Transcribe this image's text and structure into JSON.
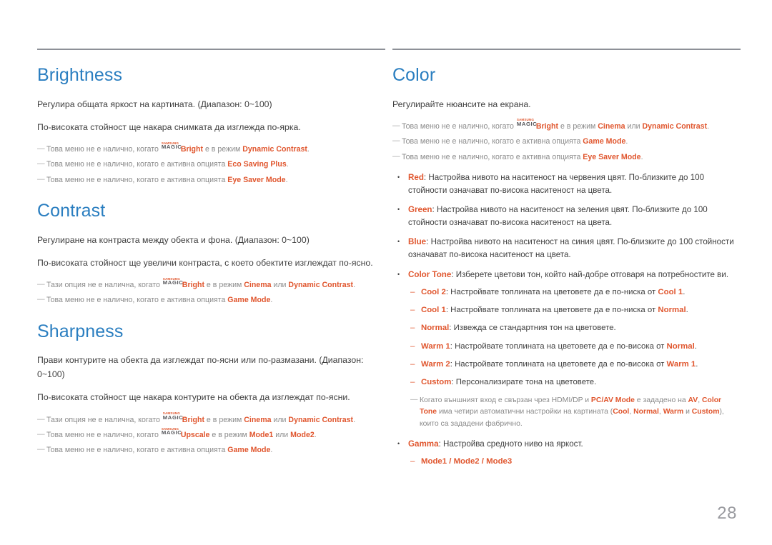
{
  "page": {
    "number": "28",
    "language": "bg",
    "accent_blue": "#2a7ec0",
    "accent_orange": "#e0562e",
    "note_gray": "#8a8a8a",
    "rule_gray": "#8d9097"
  },
  "brand": {
    "magic_top": "SAMSUNG",
    "magic_bottom": "MAGIC"
  },
  "left_column": {
    "sections": [
      {
        "title": "Brightness",
        "body": [
          "Регулира общата яркост на картината. (Диапазон: 0~100)",
          "По-високата стойност ще накара снимката да изглежда по-ярка."
        ],
        "notes": [
          {
            "mark": "—",
            "parts": [
              {
                "t": "Това меню не е налично, когато ",
                "style": "plain"
              },
              {
                "t": "magic",
                "style": "magic"
              },
              {
                "t": "Bright",
                "style": "kw"
              },
              {
                "t": " е в режим ",
                "style": "plain"
              },
              {
                "t": "Dynamic Contrast",
                "style": "kw"
              },
              {
                "t": ".",
                "style": "plain"
              }
            ]
          },
          {
            "mark": "—",
            "parts": [
              {
                "t": "Това меню не е налично, когато е активна опцията ",
                "style": "plain"
              },
              {
                "t": "Eco Saving Plus",
                "style": "kw"
              },
              {
                "t": ".",
                "style": "plain"
              }
            ]
          },
          {
            "mark": "—",
            "parts": [
              {
                "t": "Това меню не е налично, когато е активна опцията ",
                "style": "plain"
              },
              {
                "t": "Eye Saver Mode",
                "style": "kw"
              },
              {
                "t": ".",
                "style": "plain"
              }
            ]
          }
        ]
      },
      {
        "title": "Contrast",
        "body": [
          "Регулиране на контраста между обекта и фона. (Диапазон: 0~100)",
          "По-високата стойност ще увеличи контраста, с което обектите изглеждат по-ясно."
        ],
        "notes": [
          {
            "mark": "—",
            "parts": [
              {
                "t": "Тази опция не е налична, когато ",
                "style": "plain"
              },
              {
                "t": "magic",
                "style": "magic"
              },
              {
                "t": "Bright",
                "style": "kw"
              },
              {
                "t": " е в режим ",
                "style": "plain"
              },
              {
                "t": "Cinema",
                "style": "kw"
              },
              {
                "t": " или ",
                "style": "plain"
              },
              {
                "t": "Dynamic Contrast",
                "style": "kw"
              },
              {
                "t": ".",
                "style": "plain"
              }
            ]
          },
          {
            "mark": "—",
            "parts": [
              {
                "t": "Това меню не е налично, когато е активна опцията ",
                "style": "plain"
              },
              {
                "t": "Game Mode",
                "style": "kw"
              },
              {
                "t": ".",
                "style": "plain"
              }
            ]
          }
        ]
      },
      {
        "title": "Sharpness",
        "body": [
          "Прави контурите на обекта да изглеждат по-ясни или по-размазани. (Диапазон: 0~100)",
          "По-високата стойност ще накара контурите на обекта да изглеждат по-ясни."
        ],
        "notes": [
          {
            "mark": "—",
            "parts": [
              {
                "t": "Тази опция не е налична, когато ",
                "style": "plain"
              },
              {
                "t": "magic",
                "style": "magic"
              },
              {
                "t": "Bright",
                "style": "kw"
              },
              {
                "t": " е в режим ",
                "style": "plain"
              },
              {
                "t": "Cinema",
                "style": "kw"
              },
              {
                "t": " или ",
                "style": "plain"
              },
              {
                "t": "Dynamic Contrast",
                "style": "kw"
              },
              {
                "t": ".",
                "style": "plain"
              }
            ]
          },
          {
            "mark": "—",
            "parts": [
              {
                "t": "Това меню не е налично, когато ",
                "style": "plain"
              },
              {
                "t": "magic",
                "style": "magic"
              },
              {
                "t": "Upscale",
                "style": "kw"
              },
              {
                "t": " е в режим ",
                "style": "plain"
              },
              {
                "t": "Mode1",
                "style": "kw"
              },
              {
                "t": " или ",
                "style": "plain"
              },
              {
                "t": "Mode2",
                "style": "kw"
              },
              {
                "t": ".",
                "style": "plain"
              }
            ]
          },
          {
            "mark": "—",
            "parts": [
              {
                "t": "Това меню не е налично, когато е активна опцията ",
                "style": "plain"
              },
              {
                "t": "Game Mode",
                "style": "kw"
              },
              {
                "t": ".",
                "style": "plain"
              }
            ]
          }
        ]
      }
    ]
  },
  "right_column": {
    "sections": [
      {
        "title": "Color",
        "body": [
          "Регулирайте нюансите на екрана."
        ],
        "notes": [
          {
            "mark": "—",
            "parts": [
              {
                "t": "Това меню не е налично, когато ",
                "style": "plain"
              },
              {
                "t": "magic",
                "style": "magic"
              },
              {
                "t": "Bright",
                "style": "kw"
              },
              {
                "t": " е в режим ",
                "style": "plain"
              },
              {
                "t": "Cinema",
                "style": "kw"
              },
              {
                "t": " или ",
                "style": "plain"
              },
              {
                "t": "Dynamic Contrast",
                "style": "kw"
              },
              {
                "t": ".",
                "style": "plain"
              }
            ]
          },
          {
            "mark": "—",
            "parts": [
              {
                "t": "Това меню не е налично, когато е активна опцията ",
                "style": "plain"
              },
              {
                "t": "Game Mode",
                "style": "kw"
              },
              {
                "t": ".",
                "style": "plain"
              }
            ]
          },
          {
            "mark": "—",
            "parts": [
              {
                "t": "Това меню не е налично, когато е активна опцията ",
                "style": "plain"
              },
              {
                "t": "Eye Saver Mode",
                "style": "kw"
              },
              {
                "t": ".",
                "style": "plain"
              }
            ]
          }
        ],
        "items": [
          {
            "kind": "bullet",
            "mark": "•",
            "parts": [
              {
                "t": "Red",
                "style": "kw"
              },
              {
                "t": ": Настройва нивото на наситеност на червения цвят. По-близките до 100 стойности означават по-висока наситеност на цвета.",
                "style": "plain"
              }
            ]
          },
          {
            "kind": "bullet",
            "mark": "•",
            "parts": [
              {
                "t": "Green",
                "style": "kw"
              },
              {
                "t": ": Настройва нивото на наситеност на зеления цвят. По-близките до 100 стойности означават по-висока наситеност на цвета.",
                "style": "plain"
              }
            ]
          },
          {
            "kind": "bullet",
            "mark": "•",
            "parts": [
              {
                "t": "Blue",
                "style": "kw"
              },
              {
                "t": ": Настройва нивото на наситеност на синия цвят. По-близките до 100 стойности означават по-висока наситеност на цвета.",
                "style": "plain"
              }
            ]
          },
          {
            "kind": "bullet",
            "mark": "•",
            "parts": [
              {
                "t": "Color Tone",
                "style": "kw"
              },
              {
                "t": ": Изберете цветови тон, който най-добре отговаря на потребностите ви.",
                "style": "plain"
              }
            ]
          },
          {
            "kind": "sub",
            "mark": "–",
            "parts": [
              {
                "t": "Cool 2",
                "style": "kw"
              },
              {
                "t": ": Настройвате топлината на цветовете да е по-ниска от ",
                "style": "plain"
              },
              {
                "t": "Cool 1",
                "style": "kw"
              },
              {
                "t": ".",
                "style": "plain"
              }
            ]
          },
          {
            "kind": "sub",
            "mark": "–",
            "parts": [
              {
                "t": "Cool 1",
                "style": "kw"
              },
              {
                "t": ": Настройвате топлината на цветовете да е по-ниска от ",
                "style": "plain"
              },
              {
                "t": "Normal",
                "style": "kw"
              },
              {
                "t": ".",
                "style": "plain"
              }
            ]
          },
          {
            "kind": "sub",
            "mark": "–",
            "parts": [
              {
                "t": "Normal",
                "style": "kw"
              },
              {
                "t": ": Извежда се стандартния тон на цветовете.",
                "style": "plain"
              }
            ]
          },
          {
            "kind": "sub",
            "mark": "–",
            "parts": [
              {
                "t": "Warm 1",
                "style": "kw"
              },
              {
                "t": ": Настройвате топлината на цветовете да е по-висока от ",
                "style": "plain"
              },
              {
                "t": "Normal",
                "style": "kw"
              },
              {
                "t": ".",
                "style": "plain"
              }
            ]
          },
          {
            "kind": "sub",
            "mark": "–",
            "parts": [
              {
                "t": "Warm 2",
                "style": "kw"
              },
              {
                "t": ": Настройвате топлината на цветовете да е по-висока от ",
                "style": "plain"
              },
              {
                "t": "Warm 1",
                "style": "kw"
              },
              {
                "t": ".",
                "style": "plain"
              }
            ]
          },
          {
            "kind": "sub",
            "mark": "–",
            "parts": [
              {
                "t": "Custom",
                "style": "kw"
              },
              {
                "t": ": Персонализирате тона на цветовете.",
                "style": "plain"
              }
            ]
          },
          {
            "kind": "subnote",
            "mark": "—",
            "parts": [
              {
                "t": "Когато външният вход е свързан чрез HDMI/DP и ",
                "style": "plain"
              },
              {
                "t": "PC/AV Mode",
                "style": "kw"
              },
              {
                "t": " е зададено на ",
                "style": "plain"
              },
              {
                "t": "AV",
                "style": "kw"
              },
              {
                "t": ", ",
                "style": "plain"
              },
              {
                "t": "Color Tone",
                "style": "kw"
              },
              {
                "t": " има четири автоматични настройки на картината (",
                "style": "plain"
              },
              {
                "t": "Cool",
                "style": "kw"
              },
              {
                "t": ", ",
                "style": "plain"
              },
              {
                "t": "Normal",
                "style": "kw"
              },
              {
                "t": ", ",
                "style": "plain"
              },
              {
                "t": "Warm",
                "style": "kw"
              },
              {
                "t": " и ",
                "style": "plain"
              },
              {
                "t": "Custom",
                "style": "kw"
              },
              {
                "t": "), които са зададени фабрично.",
                "style": "plain"
              }
            ]
          },
          {
            "kind": "bullet",
            "mark": "•",
            "parts": [
              {
                "t": "Gamma",
                "style": "kw"
              },
              {
                "t": ": Настройва средното ниво на яркост.",
                "style": "plain"
              }
            ]
          },
          {
            "kind": "sub",
            "mark": "–",
            "parts": [
              {
                "t": "Mode1 / Mode2 / Mode3",
                "style": "kw"
              }
            ]
          }
        ]
      }
    ]
  }
}
